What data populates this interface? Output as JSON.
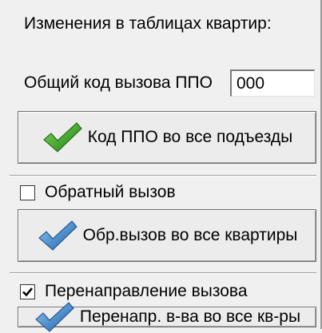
{
  "changes_label": "Изменения в таблицах квартир:",
  "common_code": {
    "label": "Общий код вызова ППО",
    "value": "000"
  },
  "buttons": {
    "code_all_entrances": "Код ППО во все подъезды",
    "callback_all_apartments": "Обр.вызов во все квартиры",
    "redirect_all_apartments": "Перенапр. в-ва во все кв-ры"
  },
  "checkboxes": {
    "callback": {
      "label": "Обратный вызов",
      "checked": false
    },
    "redirect": {
      "label": "Перенаправление вызова",
      "checked": true
    }
  },
  "icons": {
    "check_green": "green-check-icon",
    "check_blue": "blue-check-icon"
  },
  "colors": {
    "check_green": "#2e9e1e",
    "check_blue": "#2a74b8"
  }
}
